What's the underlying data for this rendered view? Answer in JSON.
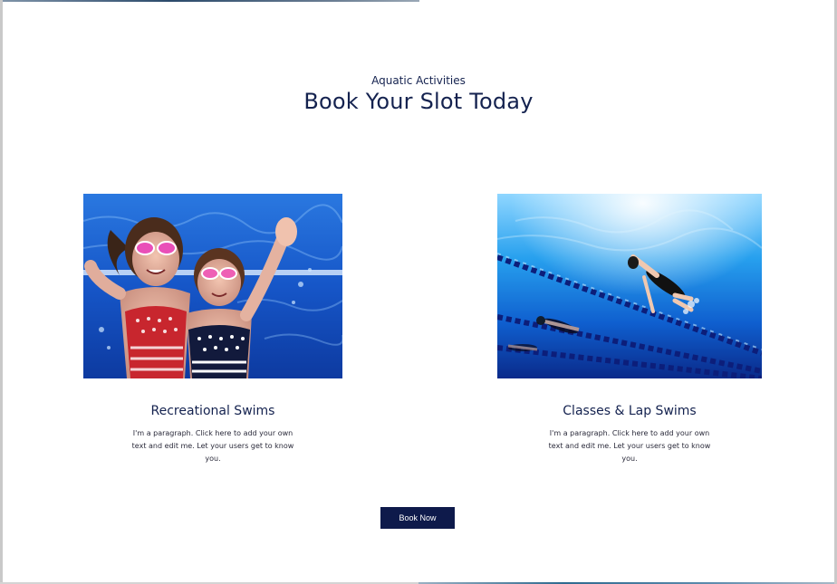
{
  "section": {
    "eyebrow": "Aquatic Activities",
    "heading": "Book Your Slot Today"
  },
  "cards": [
    {
      "title": "Recreational Swims",
      "text": "I'm a paragraph. Click here to add your own text and edit me. Let your users get to know you.",
      "image": "kids-underwater-photo"
    },
    {
      "title": "Classes & Lap Swims",
      "text": "I'm a paragraph. Click here to add your own text and edit me. Let your users get to know you.",
      "image": "lap-swimmers-photo"
    }
  ],
  "cta": {
    "label": "Book Now"
  },
  "colors": {
    "heading": "#14224f",
    "button_bg": "#0e1a4b",
    "button_text": "#ffffff",
    "pool_blue": "#1a56c4"
  }
}
